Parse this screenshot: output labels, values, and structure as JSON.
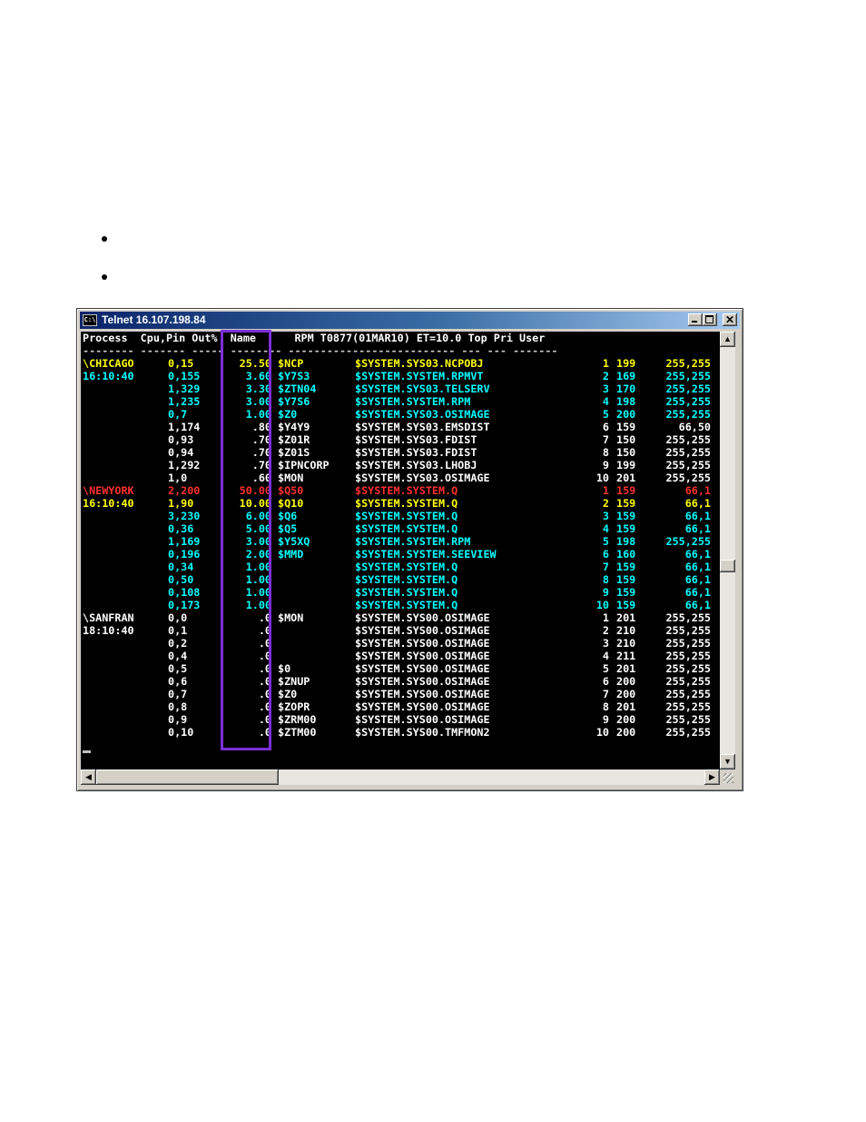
{
  "bullets": [
    "",
    ""
  ],
  "window": {
    "title": "Telnet 16.107.198.84",
    "icon_label": "C:\\"
  },
  "colors": {
    "yellow": "#ffff00",
    "cyan": "#00ffff",
    "white": "#ffffff",
    "red": "#ff3030",
    "highlight_box": "#7b2fd6",
    "terminal_bg": "#000000"
  },
  "terminal": {
    "header": "Process  Cpu,Pin Out%  Name      RPM T0877(01MAR10) ET=10.0 Top Pri User",
    "divider": "-------- ------- ----- -------- -------------------------- --- --- -------",
    "rows": [
      {
        "process": "\\CHICAGO",
        "cpu": "0,15",
        "out": "25.50",
        "name": "$NCP",
        "program": "$SYSTEM.SYS03.NCPOBJ",
        "top": "1",
        "pri": "199",
        "user": "255,255",
        "color": "yellow"
      },
      {
        "process": "16:10:40",
        "cpu": "0,155",
        "out": "3.60",
        "name": "$Y7S3",
        "program": "$SYSTEM.SYSTEM.RPMVT",
        "top": "2",
        "pri": "169",
        "user": "255,255",
        "color": "cyan"
      },
      {
        "process": "",
        "cpu": "1,329",
        "out": "3.30",
        "name": "$ZTN04",
        "program": "$SYSTEM.SYS03.TELSERV",
        "top": "3",
        "pri": "170",
        "user": "255,255",
        "color": "cyan"
      },
      {
        "process": "",
        "cpu": "1,235",
        "out": "3.00",
        "name": "$Y7S6",
        "program": "$SYSTEM.SYSTEM.RPM",
        "top": "4",
        "pri": "198",
        "user": "255,255",
        "color": "cyan"
      },
      {
        "process": "",
        "cpu": "0,7",
        "out": "1.00",
        "name": "$Z0",
        "program": "$SYSTEM.SYS03.OSIMAGE",
        "top": "5",
        "pri": "200",
        "user": "255,255",
        "color": "cyan"
      },
      {
        "process": "",
        "cpu": "1,174",
        "out": ".80",
        "name": "$Y4Y9",
        "program": "$SYSTEM.SYS03.EMSDIST",
        "top": "6",
        "pri": "159",
        "user": "66,50",
        "color": "white"
      },
      {
        "process": "",
        "cpu": "0,93",
        "out": ".70",
        "name": "$Z01R",
        "program": "$SYSTEM.SYS03.FDIST",
        "top": "7",
        "pri": "150",
        "user": "255,255",
        "color": "white"
      },
      {
        "process": "",
        "cpu": "0,94",
        "out": ".70",
        "name": "$Z01S",
        "program": "$SYSTEM.SYS03.FDIST",
        "top": "8",
        "pri": "150",
        "user": "255,255",
        "color": "white"
      },
      {
        "process": "",
        "cpu": "1,292",
        "out": ".70",
        "name": "$IPNCORP",
        "program": "$SYSTEM.SYS03.LHOBJ",
        "top": "9",
        "pri": "199",
        "user": "255,255",
        "color": "white"
      },
      {
        "process": "",
        "cpu": "1,0",
        "out": ".60",
        "name": "$MON",
        "program": "$SYSTEM.SYS03.OSIMAGE",
        "top": "10",
        "pri": "201",
        "user": "255,255",
        "color": "white"
      },
      {
        "process": "\\NEWYORK",
        "cpu": "2,200",
        "out": "50.00",
        "name": "$Q50",
        "program": "$SYSTEM.SYSTEM.Q",
        "top": "1",
        "pri": "159",
        "user": "66,1",
        "color": "red"
      },
      {
        "process": "16:10:40",
        "cpu": "1,90",
        "out": "10.00",
        "name": "$Q10",
        "program": "$SYSTEM.SYSTEM.Q",
        "top": "2",
        "pri": "159",
        "user": "66,1",
        "color": "yellow"
      },
      {
        "process": "",
        "cpu": "3,230",
        "out": "6.00",
        "name": "$Q6",
        "program": "$SYSTEM.SYSTEM.Q",
        "top": "3",
        "pri": "159",
        "user": "66,1",
        "color": "cyan"
      },
      {
        "process": "",
        "cpu": "0,36",
        "out": "5.00",
        "name": "$Q5",
        "program": "$SYSTEM.SYSTEM.Q",
        "top": "4",
        "pri": "159",
        "user": "66,1",
        "color": "cyan"
      },
      {
        "process": "",
        "cpu": "1,169",
        "out": "3.00",
        "name": "$Y5XQ",
        "program": "$SYSTEM.SYSTEM.RPM",
        "top": "5",
        "pri": "198",
        "user": "255,255",
        "color": "cyan"
      },
      {
        "process": "",
        "cpu": "0,196",
        "out": "2.00",
        "name": "$MMD",
        "program": "$SYSTEM.SYSTEM.SEEVIEW",
        "top": "6",
        "pri": "160",
        "user": "66,1",
        "color": "cyan"
      },
      {
        "process": "",
        "cpu": "0,34",
        "out": "1.00",
        "name": "",
        "program": "$SYSTEM.SYSTEM.Q",
        "top": "7",
        "pri": "159",
        "user": "66,1",
        "color": "cyan"
      },
      {
        "process": "",
        "cpu": "0,50",
        "out": "1.00",
        "name": "",
        "program": "$SYSTEM.SYSTEM.Q",
        "top": "8",
        "pri": "159",
        "user": "66,1",
        "color": "cyan"
      },
      {
        "process": "",
        "cpu": "0,108",
        "out": "1.00",
        "name": "",
        "program": "$SYSTEM.SYSTEM.Q",
        "top": "9",
        "pri": "159",
        "user": "66,1",
        "color": "cyan"
      },
      {
        "process": "",
        "cpu": "0,173",
        "out": "1.00",
        "name": "",
        "program": "$SYSTEM.SYSTEM.Q",
        "top": "10",
        "pri": "159",
        "user": "66,1",
        "color": "cyan"
      },
      {
        "process": "\\SANFRAN",
        "cpu": "0,0",
        "out": ".0",
        "name": "$MON",
        "program": "$SYSTEM.SYS00.OSIMAGE",
        "top": "1",
        "pri": "201",
        "user": "255,255",
        "color": "white"
      },
      {
        "process": "18:10:40",
        "cpu": "0,1",
        "out": ".0",
        "name": "",
        "program": "$SYSTEM.SYS00.OSIMAGE",
        "top": "2",
        "pri": "210",
        "user": "255,255",
        "color": "white"
      },
      {
        "process": "",
        "cpu": "0,2",
        "out": ".0",
        "name": "",
        "program": "$SYSTEM.SYS00.OSIMAGE",
        "top": "3",
        "pri": "210",
        "user": "255,255",
        "color": "white"
      },
      {
        "process": "",
        "cpu": "0,4",
        "out": ".0",
        "name": "",
        "program": "$SYSTEM.SYS00.OSIMAGE",
        "top": "4",
        "pri": "211",
        "user": "255,255",
        "color": "white"
      },
      {
        "process": "",
        "cpu": "0,5",
        "out": ".0",
        "name": "$0",
        "program": "$SYSTEM.SYS00.OSIMAGE",
        "top": "5",
        "pri": "201",
        "user": "255,255",
        "color": "white"
      },
      {
        "process": "",
        "cpu": "0,6",
        "out": ".0",
        "name": "$ZNUP",
        "program": "$SYSTEM.SYS00.OSIMAGE",
        "top": "6",
        "pri": "200",
        "user": "255,255",
        "color": "white"
      },
      {
        "process": "",
        "cpu": "0,7",
        "out": ".0",
        "name": "$Z0",
        "program": "$SYSTEM.SYS00.OSIMAGE",
        "top": "7",
        "pri": "200",
        "user": "255,255",
        "color": "white"
      },
      {
        "process": "",
        "cpu": "0,8",
        "out": ".0",
        "name": "$ZOPR",
        "program": "$SYSTEM.SYS00.OSIMAGE",
        "top": "8",
        "pri": "201",
        "user": "255,255",
        "color": "white"
      },
      {
        "process": "",
        "cpu": "0,9",
        "out": ".0",
        "name": "$ZRM00",
        "program": "$SYSTEM.SYS00.OSIMAGE",
        "top": "9",
        "pri": "200",
        "user": "255,255",
        "color": "white"
      },
      {
        "process": "",
        "cpu": "0,10",
        "out": ".0",
        "name": "$ZTM00",
        "program": "$SYSTEM.SYS00.TMFMON2",
        "top": "10",
        "pri": "200",
        "user": "255,255",
        "color": "white"
      }
    ]
  },
  "scrollbars": {
    "vertical_position": 0.54,
    "horizontal_position": 0.0,
    "horizontal_visible_fraction": 0.3
  }
}
